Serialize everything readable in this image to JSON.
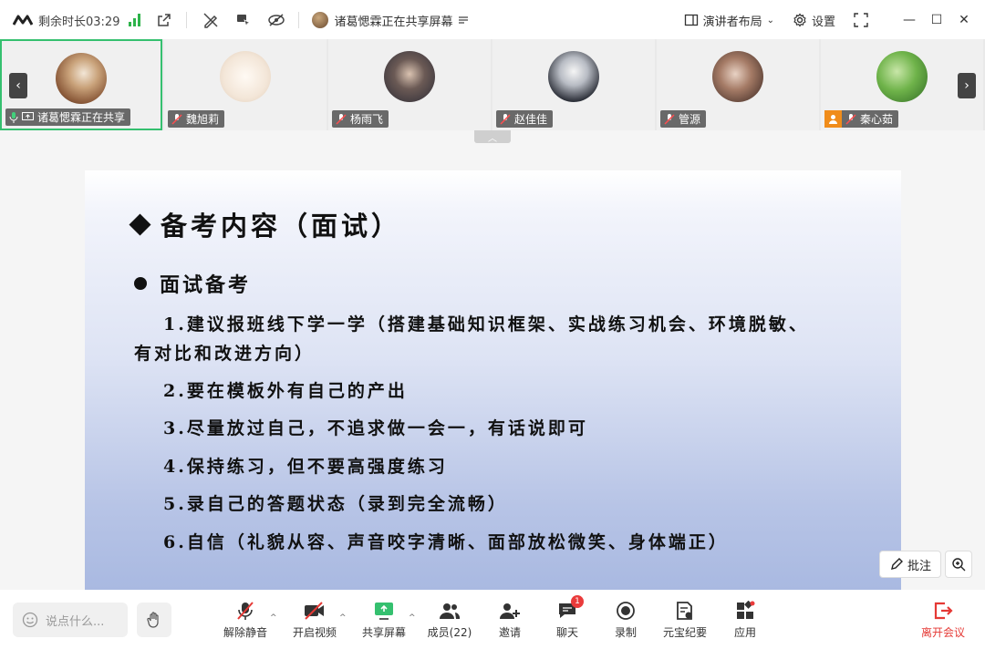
{
  "topbar": {
    "timer": "剩余时长03:29",
    "sharing_text": "诸葛愢霖正在共享屏幕",
    "layout_label": "演讲者布局",
    "settings_label": "设置"
  },
  "participants": [
    {
      "name": "诸葛愢霖正在共享"
    },
    {
      "name": "魏旭莉"
    },
    {
      "name": "杨雨飞"
    },
    {
      "name": "赵佳佳"
    },
    {
      "name": "管源"
    },
    {
      "name": "秦心茹"
    }
  ],
  "slide": {
    "title": "备考内容（面试）",
    "subtitle": "面试备考",
    "items": [
      "1.建议报班线下学一学（搭建基础知识框架、实战练习机会、环境脱敏、",
      "有对比和改进方向）",
      "2.要在模板外有自己的产出",
      "3.尽量放过自己，不追求做一会一，有话说即可",
      "4.保持练习，但不要高强度练习",
      "5.录自己的答题状态（录到完全流畅）",
      "6.自信（礼貌从容、声音咬字清晰、面部放松微笑、身体端正）"
    ]
  },
  "annotate_label": "批注",
  "bottombar": {
    "chat_placeholder": "说点什么...",
    "unmute": "解除静音",
    "video": "开启视频",
    "share": "共享屏幕",
    "members": "成员(22)",
    "invite": "邀请",
    "chat": "聊天",
    "chat_badge": "1",
    "record": "录制",
    "yuanbao": "元宝纪要",
    "apps": "应用",
    "leave": "离开会议"
  },
  "colors": {
    "accent_green": "#35c06f",
    "signal_green": "#2db34a",
    "leave_red": "#e53935",
    "badge_red": "#ea3b3b"
  }
}
